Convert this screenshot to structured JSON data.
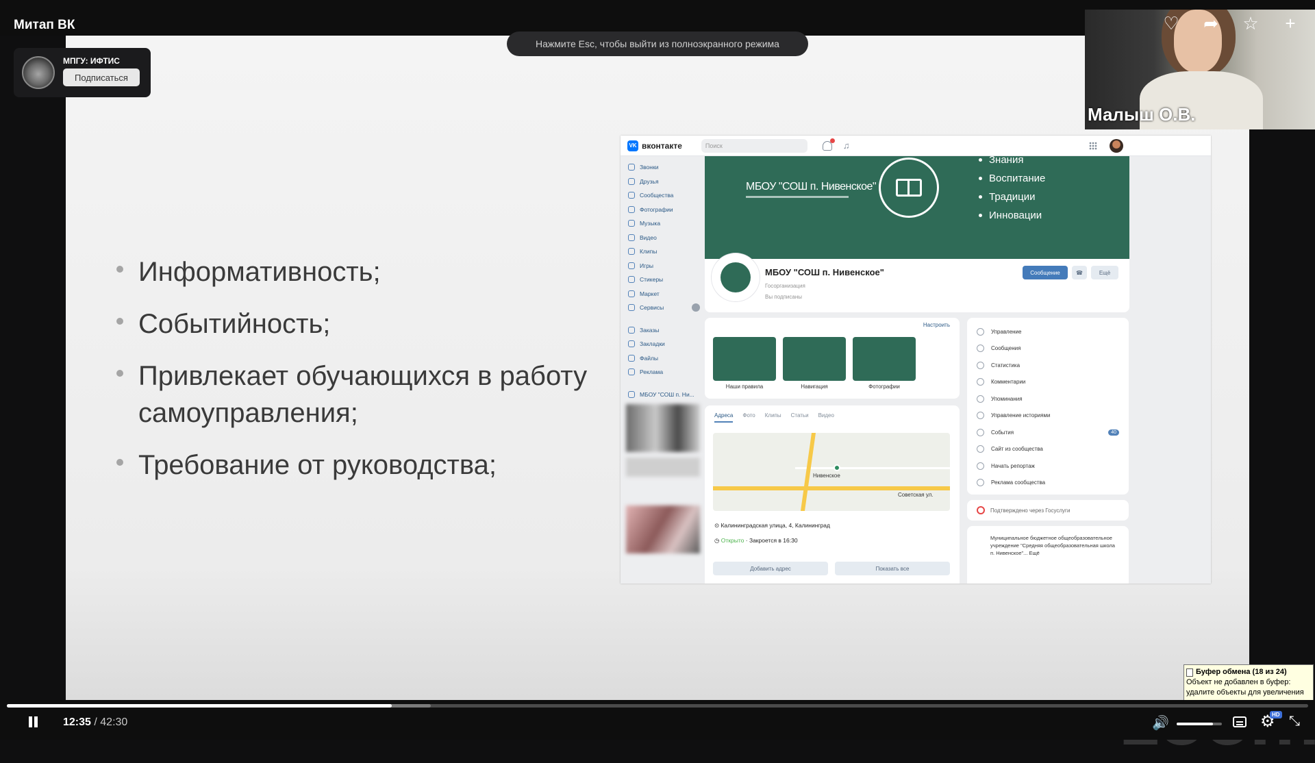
{
  "title": "Митап ВК",
  "fullscreen_hint": "Нажмите Esc, чтобы выйти из полноэкранного режима",
  "channel": {
    "name": "МПГУ: ИФТИС",
    "subscribe_label": "Подписаться"
  },
  "top_actions": {
    "like": "♡",
    "share": "➦",
    "favorite": "☆",
    "add": "+"
  },
  "camera": {
    "name": "Малыш О.В."
  },
  "slide": {
    "bullets": [
      "Информативность;",
      "Событийность;",
      "Привлекает обучающихся в работу самоуправления;",
      "Требование от руководства;"
    ]
  },
  "vk": {
    "brand": "вконтакте",
    "logo": "VK",
    "search_placeholder": "Поиск",
    "sidebar": [
      "Звонки",
      "Друзья",
      "Сообщества",
      "Фотографии",
      "Музыка",
      "Видео",
      "Клипы",
      "Игры",
      "Стикеры",
      "Маркет",
      "Сервисы"
    ],
    "sidebar2": [
      "Заказы",
      "Закладки",
      "Файлы",
      "Реклама"
    ],
    "sidebar3": "МБОУ \"СОШ п. Ни...",
    "cover": {
      "title": "МБОУ \"СОШ п. Нивенское\"",
      "values": [
        "Знания",
        "Воспитание",
        "Традиции",
        "Инновации"
      ]
    },
    "group_name": "МБОУ \"СОШ п. Нивенское\"",
    "group_type": "Госорганизация",
    "subscribed": "Вы подписаны",
    "message_btn": "Сообщение",
    "more_btn": "Ещё",
    "configure": "Настроить",
    "tiles": [
      "Наши правила",
      "Навигация",
      "Фотографии"
    ],
    "tabs": [
      "Адреса",
      "Фото",
      "Клипы",
      "Статьи",
      "Видео"
    ],
    "map_labels": {
      "town": "Нивенское",
      "street": "Советская ул."
    },
    "address": "Калининградская улица, 4, Калининград",
    "open_status": "Открыто",
    "close_time": "· Закроется в 16:30",
    "add_address": "Добавить адрес",
    "show_all": "Показать все",
    "admin_menu": [
      "Управление",
      "Сообщения",
      "Статистика",
      "Комментарии",
      "Упоминания",
      "Управление историями",
      "События",
      "Сайт из сообщества",
      "Начать репортаж",
      "Реклама сообщества"
    ],
    "events_count": "40",
    "gosuslugi": "Подтверждено через Госуслуги",
    "info": "Муниципальное бюджетное общеобразовательное учреждение \"Средняя общеобразовательная школа п. Нивенское\"... Ещё"
  },
  "watermark": "zoom",
  "toast": {
    "title": "Буфер обмена (18 из 24)",
    "body": "Объект не добавлен в буфер: удалите объекты для увеличения доступного места"
  },
  "player": {
    "current_time": "12:35",
    "separator": " / ",
    "duration": "42:30",
    "progress": 0.296,
    "buffered": 0.26,
    "volume": 0.8,
    "hd": "HD"
  }
}
